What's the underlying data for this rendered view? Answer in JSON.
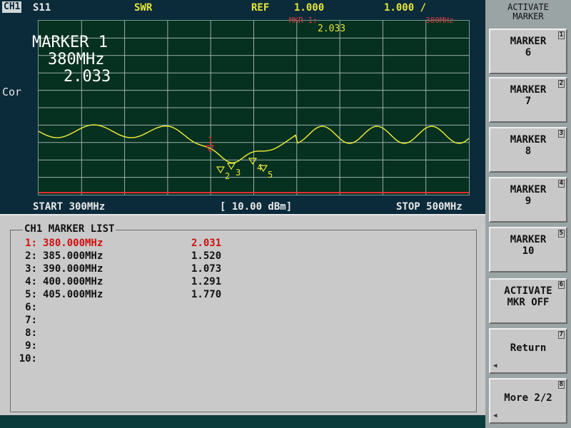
{
  "header": {
    "channel": "CH1",
    "param": "S11",
    "format": "SWR",
    "ref_label": "REF",
    "ref_value": "1.000",
    "scale": "1.000 /"
  },
  "graph": {
    "side_label": "Cor",
    "marker_readout": {
      "line1": "MARKER 1",
      "line2": "380MHz",
      "line3": "2.033"
    },
    "marker_header_label": "MKR 1:",
    "marker_header_value": "2.033",
    "marker_header_right": "380MHz",
    "start": "START 300MHz",
    "power": "[ 10.00 dBm]",
    "stop": "STOP 500MHz",
    "trace_color": "#e5e63a",
    "grid_color": "#9bb0b0",
    "marker_labels": [
      "1",
      "2",
      "3",
      "4",
      "5"
    ]
  },
  "marker_list": {
    "title": "CH1 MARKER LIST",
    "rows": [
      {
        "index": "1:",
        "freq": "380.000MHz",
        "value": "2.031",
        "active": true
      },
      {
        "index": "2:",
        "freq": "385.000MHz",
        "value": "1.520",
        "active": false
      },
      {
        "index": "3:",
        "freq": "390.000MHz",
        "value": "1.073",
        "active": false
      },
      {
        "index": "4:",
        "freq": "400.000MHz",
        "value": "1.291",
        "active": false
      },
      {
        "index": "5:",
        "freq": "405.000MHz",
        "value": "1.770",
        "active": false
      },
      {
        "index": "6:",
        "freq": "",
        "value": "",
        "active": false
      },
      {
        "index": "7:",
        "freq": "",
        "value": "",
        "active": false
      },
      {
        "index": "8:",
        "freq": "",
        "value": "",
        "active": false
      },
      {
        "index": "9:",
        "freq": "",
        "value": "",
        "active": false
      },
      {
        "index": "10:",
        "freq": "",
        "value": "",
        "active": false
      }
    ]
  },
  "softkeys": {
    "title_line1": "ACTIVATE",
    "title_line2": "MARKER",
    "keys": [
      {
        "num": "1",
        "line1": "MARKER",
        "line2": "6"
      },
      {
        "num": "2",
        "line1": "MARKER",
        "line2": "7"
      },
      {
        "num": "3",
        "line1": "MARKER",
        "line2": "8"
      },
      {
        "num": "4",
        "line1": "MARKER",
        "line2": "9"
      },
      {
        "num": "5",
        "line1": "MARKER",
        "line2": "10"
      },
      {
        "num": "6",
        "line1": "ACTIVATE",
        "line2": "MKR OFF"
      },
      {
        "num": "7",
        "line1": "Return",
        "line2": ""
      },
      {
        "num": "8",
        "line1": "More 2/2",
        "line2": ""
      }
    ]
  }
}
